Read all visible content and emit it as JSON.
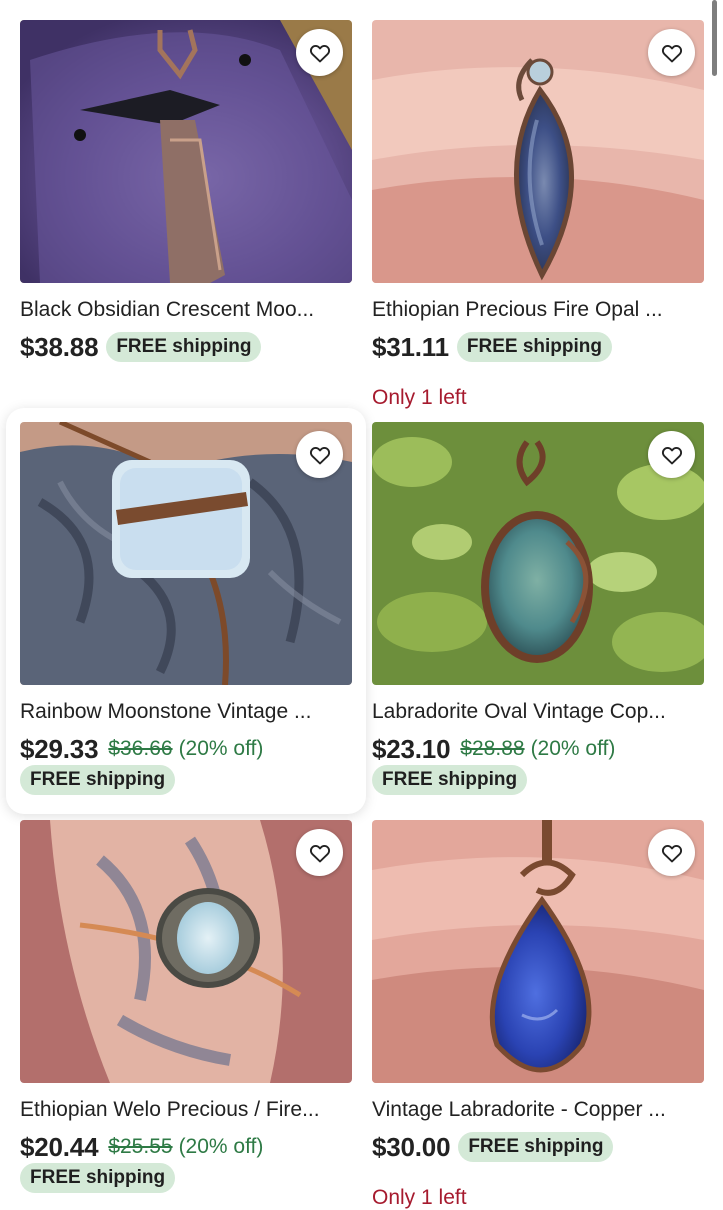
{
  "colors": {
    "free_shipping_bg": "#d4e9d7",
    "discount_text": "#2e7a45",
    "low_stock_text": "#a61a2e",
    "text": "#222222"
  },
  "listings": [
    {
      "title": "Black Obsidian Crescent Moo...",
      "price": "$38.88",
      "free_shipping": "FREE shipping",
      "favorite_icon": "heart-outline-icon"
    },
    {
      "title": "Ethiopian Precious Fire Opal ...",
      "price": "$31.11",
      "free_shipping": "FREE shipping",
      "stock": "Only 1 left",
      "favorite_icon": "heart-outline-icon"
    },
    {
      "title": "Rainbow Moonstone Vintage ...",
      "price": "$29.33",
      "original_price": "$36.66",
      "discount": "(20% off)",
      "free_shipping": "FREE shipping",
      "favorite_icon": "heart-outline-icon"
    },
    {
      "title": "Labradorite Oval Vintage Cop...",
      "price": "$23.10",
      "original_price": "$28.88",
      "discount": "(20% off)",
      "free_shipping": "FREE shipping",
      "favorite_icon": "heart-outline-icon"
    },
    {
      "title": "Ethiopian Welo Precious / Fire...",
      "price": "$20.44",
      "original_price": "$25.55",
      "discount": "(20% off)",
      "free_shipping": "FREE shipping",
      "favorite_icon": "heart-outline-icon"
    },
    {
      "title": "Vintage Labradorite - Copper ...",
      "price": "$30.00",
      "free_shipping": "FREE shipping",
      "stock": "Only 1 left",
      "favorite_icon": "heart-outline-icon"
    }
  ]
}
